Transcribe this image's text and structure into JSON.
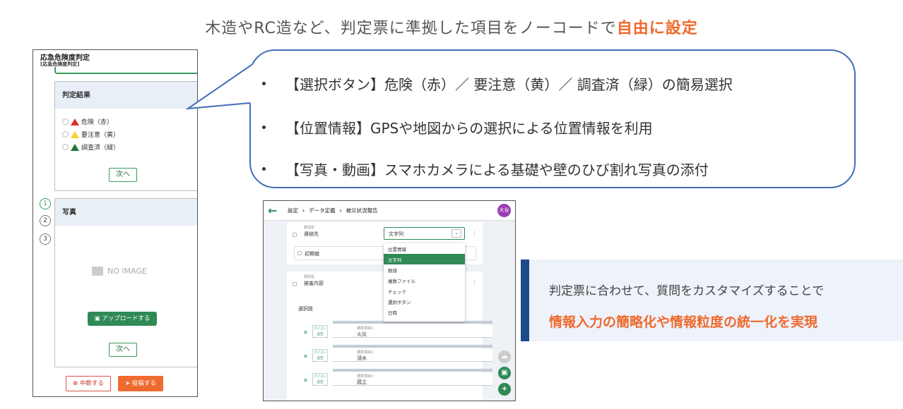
{
  "headline": {
    "prefix": "木造やRC造など、判定票に準拠した項目をノーコードで",
    "highlight": "自由に設定"
  },
  "colors": {
    "accent_orange": "#ef6a2e",
    "primary_green": "#2f8a56",
    "bubble_blue": "#3f6fb5",
    "info_bar": "#1f4a8a"
  },
  "phone": {
    "title": "応急危険度判定",
    "subtitle": "[応急危険度判定]",
    "card1": {
      "header": "判定結果",
      "options": [
        {
          "label": "危険（赤）",
          "icon": "warning-red-icon"
        },
        {
          "label": "要注意（黄）",
          "icon": "warning-yellow-icon"
        },
        {
          "label": "調査済（緑）",
          "icon": "warning-green-icon"
        }
      ],
      "next_label": "次へ"
    },
    "steps": [
      "1",
      "2",
      "3"
    ],
    "card2": {
      "header": "写真",
      "no_image": "NO IMAGE",
      "upload_label": "アップロードする",
      "next_label": "次へ"
    },
    "stop_label": "中断する",
    "post_label": "投稿する"
  },
  "bubble": {
    "items": [
      "【選択ボタン】危険（赤）／ 要注意（黄）／ 調査済（緑）の簡易選択",
      "【位置情報】GPSや地図からの選択による位置情報を利用",
      "【写真・動画】スマホカメラによる基礎や壁のひび割れ写真の添付"
    ]
  },
  "app": {
    "breadcrumb": [
      "設定",
      "データ定義",
      "被災状況報告"
    ],
    "avatar": "大谷",
    "field1": {
      "label_small": "質問名",
      "name": "連絡先",
      "type": "文字列"
    },
    "initial_value_label": "初期値",
    "menu_items": [
      "位置情報",
      "文字列",
      "数値",
      "複数ファイル",
      "チェック",
      "選択ボタン",
      "日時"
    ],
    "menu_selected": 1,
    "field2": {
      "label_small": "質問名",
      "name": "被害内容"
    },
    "choices_label": "選択肢",
    "choices": [
      {
        "icon_label": "アイコン設定",
        "caption": "選択項目1",
        "value": "火災"
      },
      {
        "icon_label": "アイコン設定",
        "caption": "選択項目2",
        "value": "浸水"
      },
      {
        "icon_label": "アイコン設定",
        "caption": "選択項目3",
        "value": "孤立"
      }
    ]
  },
  "info": {
    "line1": "判定票に合わせて、質問をカスタマイズすることで",
    "line2": "情報入力の簡略化や情報粒度の統一化を実現"
  }
}
